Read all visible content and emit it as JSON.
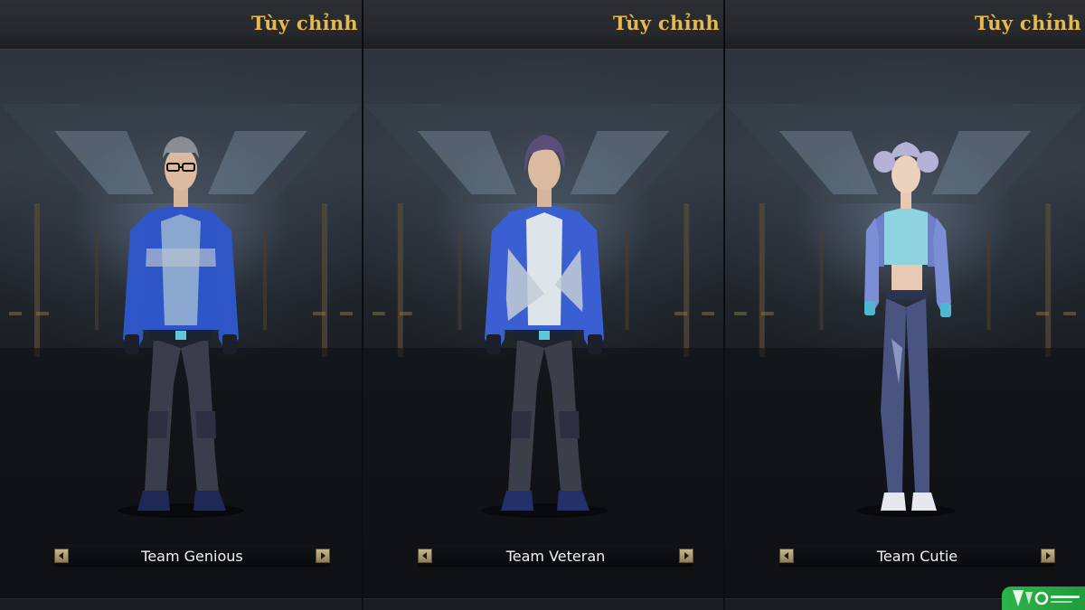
{
  "panels": [
    {
      "title": "Tùy chỉnh",
      "team_name": "Team Genious",
      "variant": "male-glasses"
    },
    {
      "title": "Tùy chỉnh",
      "team_name": "Team Veteran",
      "variant": "male-long-hair"
    },
    {
      "title": "Tùy chỉnh",
      "team_name": "Team Cutie",
      "variant": "female"
    }
  ],
  "icons": {
    "previous": "arrow-left-icon",
    "next": "arrow-right-icon"
  },
  "watermark": {
    "text": "VTConline"
  },
  "colors": {
    "title_gold": "#e8b84a",
    "jacket_blue": "#2e55c8",
    "arrow_gold": "#c9b88d",
    "watermark_green": "#2db34a"
  }
}
